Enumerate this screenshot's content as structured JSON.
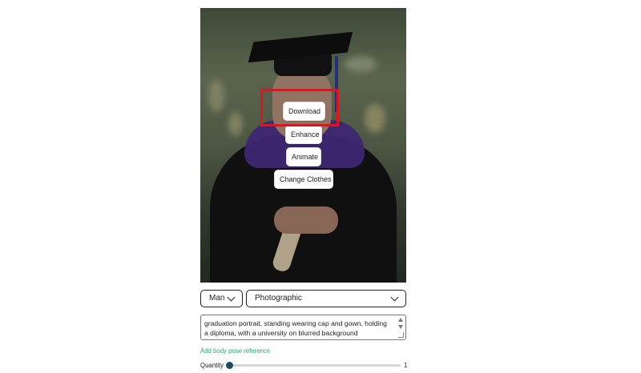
{
  "image_actions": {
    "download_label": "Download",
    "enhance_label": "Enhance",
    "animate_label": "Animate",
    "change_clothes_label": "Change Clothes"
  },
  "controls": {
    "gender_select": {
      "value": "Man"
    },
    "style_select": {
      "value": "Photographic"
    },
    "prompt": {
      "value": "graduation portrait, standing wearing cap and gown, holding a diploma, with a university on blurred background"
    },
    "add_pose_link": "Add body pose reference",
    "quantity": {
      "label": "Quantity",
      "value": "1",
      "min": 1
    }
  },
  "colors": {
    "highlight": "#e0141c",
    "link": "#2aa874",
    "slider_thumb": "#1d4c5a"
  },
  "icons": [
    "chevron-down-icon",
    "scroll-up-icon",
    "scroll-down-icon",
    "resize-handle-icon"
  ]
}
